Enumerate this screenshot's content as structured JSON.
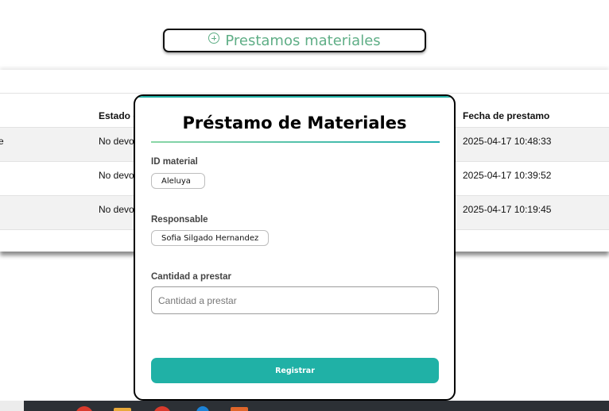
{
  "header": {
    "add_button_label": "Prestamos materiales",
    "add_icon": "plus-circle-icon",
    "accent_color": "#5fae86"
  },
  "table": {
    "columns": [
      "Estado d",
      "Fecha de prestamo"
    ],
    "rows": [
      {
        "first_col_fragment": "e",
        "estado": "No devo",
        "fecha": "2025-04-17 10:48:33"
      },
      {
        "first_col_fragment": "",
        "estado": "No devo",
        "fecha": "2025-04-17 10:39:52"
      },
      {
        "first_col_fragment": "",
        "estado": "No devo",
        "fecha": "2025-04-17 10:19:45"
      }
    ]
  },
  "modal": {
    "title": "Préstamo de Materiales",
    "fields": {
      "material": {
        "label": "ID material",
        "value": "Aleluya"
      },
      "responsable": {
        "label": "Responsable",
        "value": "Sofia Silgado Hernandez"
      },
      "cantidad": {
        "label": "Cantidad a prestar",
        "placeholder": "Cantidad a prestar",
        "value": ""
      }
    },
    "submit_label": "Registrar",
    "accent_color": "#20b1a6"
  },
  "taskbar": {
    "icons": [
      "chrome-icon",
      "folder-icon",
      "chrome-alt-icon",
      "edge-icon",
      "app-icon"
    ]
  }
}
